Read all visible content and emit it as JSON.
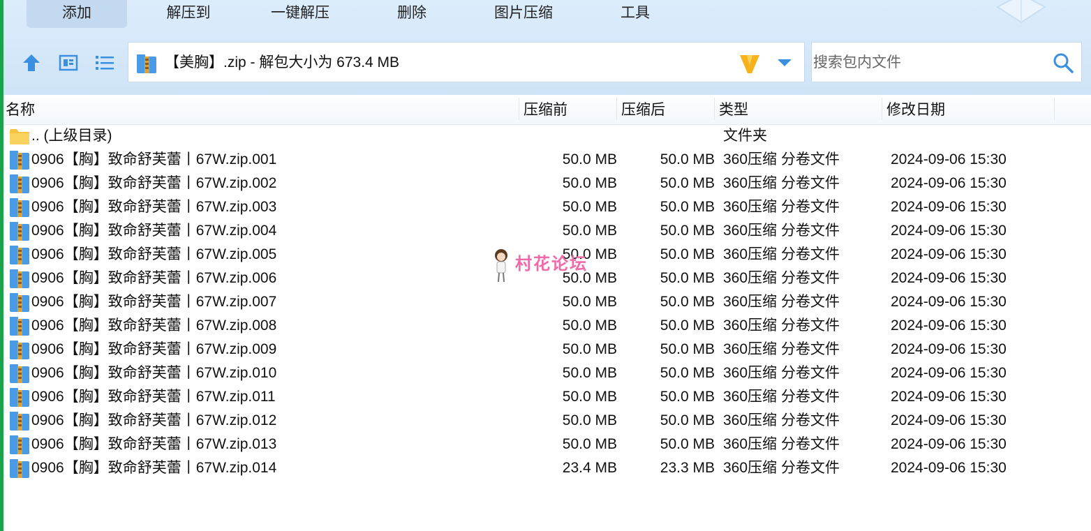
{
  "toolbar": {
    "tabs": [
      {
        "label": "添加"
      },
      {
        "label": "解压到"
      },
      {
        "label": "一键解压"
      },
      {
        "label": "删除"
      },
      {
        "label": "图片压缩"
      },
      {
        "label": "工具"
      }
    ],
    "path": "【美胸】.zip - 解包大小为 673.4 MB",
    "search_placeholder": "搜索包内文件"
  },
  "columns": {
    "name": "名称",
    "before": "压缩前",
    "after": "压缩后",
    "type": "类型",
    "date": "修改日期"
  },
  "parent_row": {
    "name": ".. (上级目录)",
    "type": "文件夹"
  },
  "files": [
    {
      "name": "0906【胸】致命舒芙蕾丨67W.zip.001",
      "before": "50.0 MB",
      "after": "50.0 MB",
      "type": "360压缩 分卷文件",
      "date": "2024-09-06 15:30"
    },
    {
      "name": "0906【胸】致命舒芙蕾丨67W.zip.002",
      "before": "50.0 MB",
      "after": "50.0 MB",
      "type": "360压缩 分卷文件",
      "date": "2024-09-06 15:30"
    },
    {
      "name": "0906【胸】致命舒芙蕾丨67W.zip.003",
      "before": "50.0 MB",
      "after": "50.0 MB",
      "type": "360压缩 分卷文件",
      "date": "2024-09-06 15:30"
    },
    {
      "name": "0906【胸】致命舒芙蕾丨67W.zip.004",
      "before": "50.0 MB",
      "after": "50.0 MB",
      "type": "360压缩 分卷文件",
      "date": "2024-09-06 15:30"
    },
    {
      "name": "0906【胸】致命舒芙蕾丨67W.zip.005",
      "before": "50.0 MB",
      "after": "50.0 MB",
      "type": "360压缩 分卷文件",
      "date": "2024-09-06 15:30"
    },
    {
      "name": "0906【胸】致命舒芙蕾丨67W.zip.006",
      "before": "50.0 MB",
      "after": "50.0 MB",
      "type": "360压缩 分卷文件",
      "date": "2024-09-06 15:30"
    },
    {
      "name": "0906【胸】致命舒芙蕾丨67W.zip.007",
      "before": "50.0 MB",
      "after": "50.0 MB",
      "type": "360压缩 分卷文件",
      "date": "2024-09-06 15:30"
    },
    {
      "name": "0906【胸】致命舒芙蕾丨67W.zip.008",
      "before": "50.0 MB",
      "after": "50.0 MB",
      "type": "360压缩 分卷文件",
      "date": "2024-09-06 15:30"
    },
    {
      "name": "0906【胸】致命舒芙蕾丨67W.zip.009",
      "before": "50.0 MB",
      "after": "50.0 MB",
      "type": "360压缩 分卷文件",
      "date": "2024-09-06 15:30"
    },
    {
      "name": "0906【胸】致命舒芙蕾丨67W.zip.010",
      "before": "50.0 MB",
      "after": "50.0 MB",
      "type": "360压缩 分卷文件",
      "date": "2024-09-06 15:30"
    },
    {
      "name": "0906【胸】致命舒芙蕾丨67W.zip.011",
      "before": "50.0 MB",
      "after": "50.0 MB",
      "type": "360压缩 分卷文件",
      "date": "2024-09-06 15:30"
    },
    {
      "name": "0906【胸】致命舒芙蕾丨67W.zip.012",
      "before": "50.0 MB",
      "after": "50.0 MB",
      "type": "360压缩 分卷文件",
      "date": "2024-09-06 15:30"
    },
    {
      "name": "0906【胸】致命舒芙蕾丨67W.zip.013",
      "before": "50.0 MB",
      "after": "50.0 MB",
      "type": "360压缩 分卷文件",
      "date": "2024-09-06 15:30"
    },
    {
      "name": "0906【胸】致命舒芙蕾丨67W.zip.014",
      "before": "23.4 MB",
      "after": "23.3 MB",
      "type": "360压缩 分卷文件",
      "date": "2024-09-06 15:30"
    }
  ],
  "watermark": {
    "text": "村花论坛"
  },
  "icons": {
    "up": "arrow-up-icon",
    "view_thumb": "thumbnail-view-icon",
    "view_list": "list-view-icon",
    "archive": "archive-icon",
    "folder": "folder-icon",
    "brand": "v-logo-icon",
    "search": "search-icon"
  },
  "colors": {
    "accent": "#3a8fe0",
    "toolbar_bg": "#d6e8f9",
    "watermark": "#f06aa8"
  }
}
